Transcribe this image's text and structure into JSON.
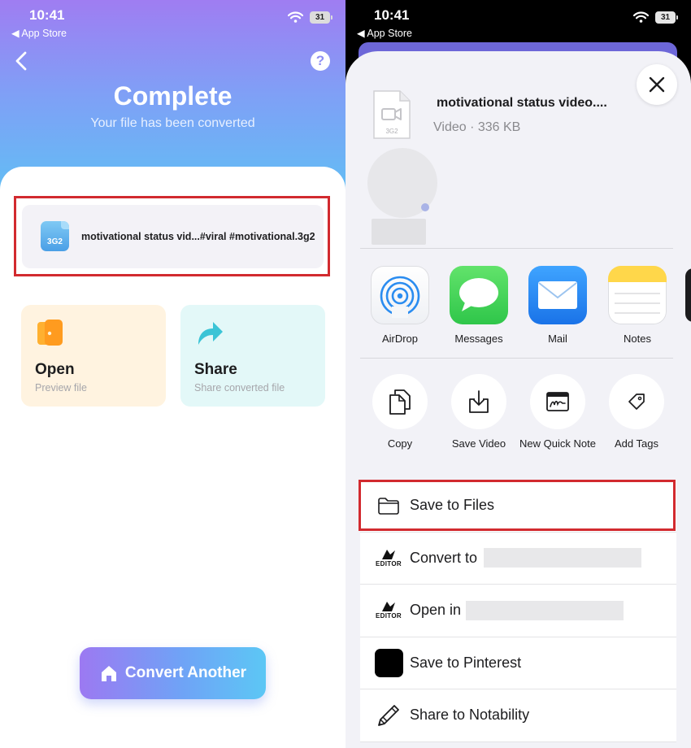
{
  "status": {
    "time": "10:41",
    "back_label": "◀ App Store",
    "battery": "31"
  },
  "left": {
    "title": "Complete",
    "subtitle": "Your file has been converted",
    "help_glyph": "?",
    "file": {
      "icon_ext": "3G2",
      "name": "motivational status vid...#viral #motivational.3g2"
    },
    "tiles": {
      "open": {
        "title": "Open",
        "subtitle": "Preview file"
      },
      "share": {
        "title": "Share",
        "subtitle": "Share converted file"
      }
    },
    "convert_button": "Convert Another",
    "colors": {
      "highlight": "#d22a2f",
      "gradient_start": "#9f7df2",
      "gradient_end": "#5cc3f4"
    }
  },
  "right": {
    "file": {
      "icon_ext": "3G2",
      "name": "motivational status video....",
      "meta": "Video · 336 KB"
    },
    "apps": [
      "AirDrop",
      "Messages",
      "Mail",
      "Notes"
    ],
    "actions": [
      "Copy",
      "Save Video",
      "New Quick Note",
      "Add Tags"
    ],
    "rows": [
      {
        "label": "Save to Files",
        "icon": "folder-icon"
      },
      {
        "label": "Convert to",
        "icon": "editor-icon",
        "logo_text": "EDITOR"
      },
      {
        "label": "Open in",
        "icon": "editor-icon",
        "logo_text": "EDITOR"
      },
      {
        "label": "Save to Pinterest",
        "icon": "pinterest-icon"
      },
      {
        "label": "Share to Notability",
        "icon": "pencil-icon"
      }
    ]
  }
}
